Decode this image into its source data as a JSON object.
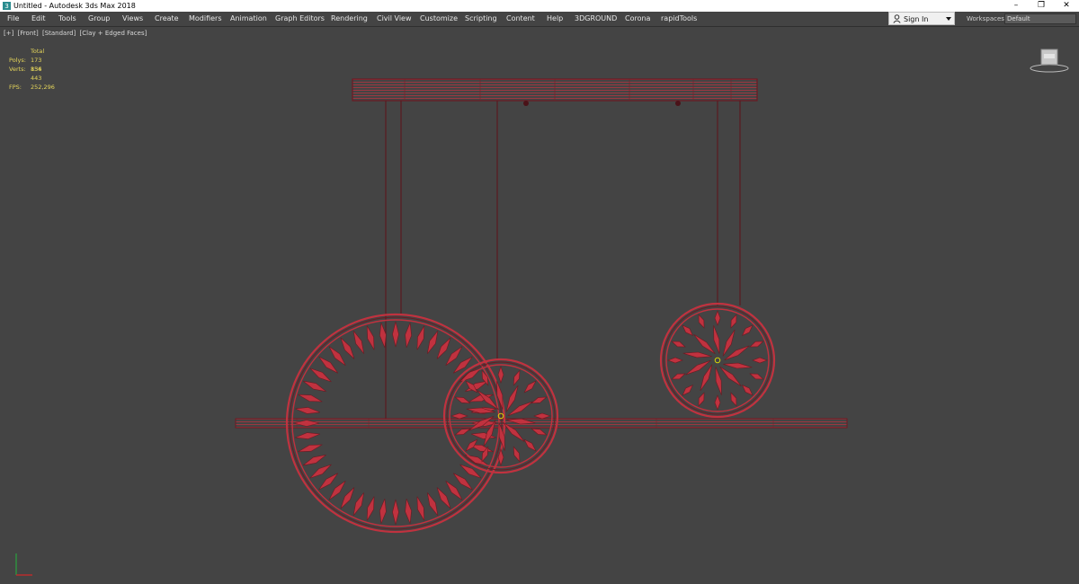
{
  "window": {
    "title": "Untitled - Autodesk 3ds Max 2018",
    "controls": [
      "minimize-icon",
      "restore-icon",
      "close-icon"
    ]
  },
  "menu": {
    "items": [
      "File",
      "Edit",
      "Tools",
      "Group",
      "Views",
      "Create",
      "Modifiers",
      "Animation",
      "Graph Editors",
      "Rendering",
      "Civil View",
      "Customize",
      "Scripting",
      "Content",
      "Help",
      "3DGROUND",
      "Corona",
      "rapidTools"
    ]
  },
  "account": {
    "signin_label": "Sign In"
  },
  "workspaces": {
    "label": "Workspaces:",
    "value": "Default"
  },
  "viewport": {
    "labels": [
      "[+]",
      "[Front]",
      "[Standard]",
      "[Clay + Edged Faces]"
    ],
    "stats": {
      "header": "Total",
      "polys_label": "Polys:",
      "polys_value": "173 856",
      "verts_label": "Verts:",
      "verts_value": "134 443",
      "fps_label": "FPS:",
      "fps_value": "252,296"
    }
  },
  "colors": {
    "viewport_bg": "#444444",
    "wire": "#c0323f",
    "wire_dark": "#6b1a22",
    "stats_text": "#e6d65a"
  },
  "icons": {
    "app": "3ds-max-logo-icon",
    "account": "user-icon",
    "viewcube": "viewcube-icon",
    "axis": "axis-gizmo-icon"
  }
}
